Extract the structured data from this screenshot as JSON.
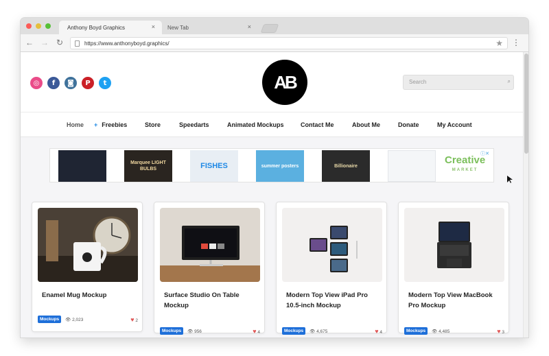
{
  "browser": {
    "tabs": [
      {
        "label": "Anthony Boyd Graphics",
        "close": "×"
      },
      {
        "label": "New Tab",
        "close": "×"
      }
    ],
    "nav": {
      "back": "←",
      "forward": "→",
      "reload": "↻"
    },
    "url": "https://www.anthonyboyd.graphics/",
    "menu": "⋮",
    "bookmark_star": "★"
  },
  "site": {
    "logo_text": "AB",
    "socials": [
      {
        "name": "dribbble",
        "glyph": "◎"
      },
      {
        "name": "facebook",
        "glyph": "f"
      },
      {
        "name": "instagram",
        "glyph": "◙"
      },
      {
        "name": "pinterest",
        "glyph": "P"
      },
      {
        "name": "twitter",
        "glyph": "t"
      }
    ],
    "search": {
      "placeholder": "Search",
      "icon": "⌕"
    },
    "menu": [
      {
        "label": "Home"
      },
      {
        "label": "Freebies",
        "prefix": "+"
      },
      {
        "label": "Store"
      },
      {
        "label": "Speedarts"
      },
      {
        "label": "Animated Mockups"
      },
      {
        "label": "Contact Me"
      },
      {
        "label": "About Me"
      },
      {
        "label": "Donate"
      },
      {
        "label": "My Account"
      }
    ]
  },
  "ad": {
    "thumbs": [
      {
        "text": ""
      },
      {
        "text": "Marquee LIGHT BULBS"
      },
      {
        "text": "FISHES"
      },
      {
        "text": "summer posters"
      },
      {
        "text": "Billionaire"
      },
      {
        "text": ""
      }
    ],
    "brand": "Creative",
    "brand_sub": "MARKET",
    "info": "ⓘ✕"
  },
  "cards": [
    {
      "title": "Enamel Mug Mockup",
      "badge": "Mockups",
      "views": "2,023",
      "likes": "2",
      "view_icon": "👁",
      "heart": "♥"
    },
    {
      "title": "Surface Studio On Table Mockup",
      "badge": "Mockups",
      "views": "956",
      "likes": "4",
      "view_icon": "👁",
      "heart": "♥"
    },
    {
      "title": "Modern Top View iPad Pro 10.5-inch Mockup",
      "badge": "Mockups",
      "views": "4,675",
      "likes": "4",
      "view_icon": "👁",
      "heart": "♥"
    },
    {
      "title": "Modern Top View MacBook Pro Mockup",
      "badge": "Mockups",
      "views": "4,485",
      "likes": "3",
      "view_icon": "👁",
      "heart": "♥"
    }
  ],
  "colors": {
    "badge": "#1e6fd9",
    "heart": "#e05656",
    "accent_plus": "#1e88e5"
  }
}
